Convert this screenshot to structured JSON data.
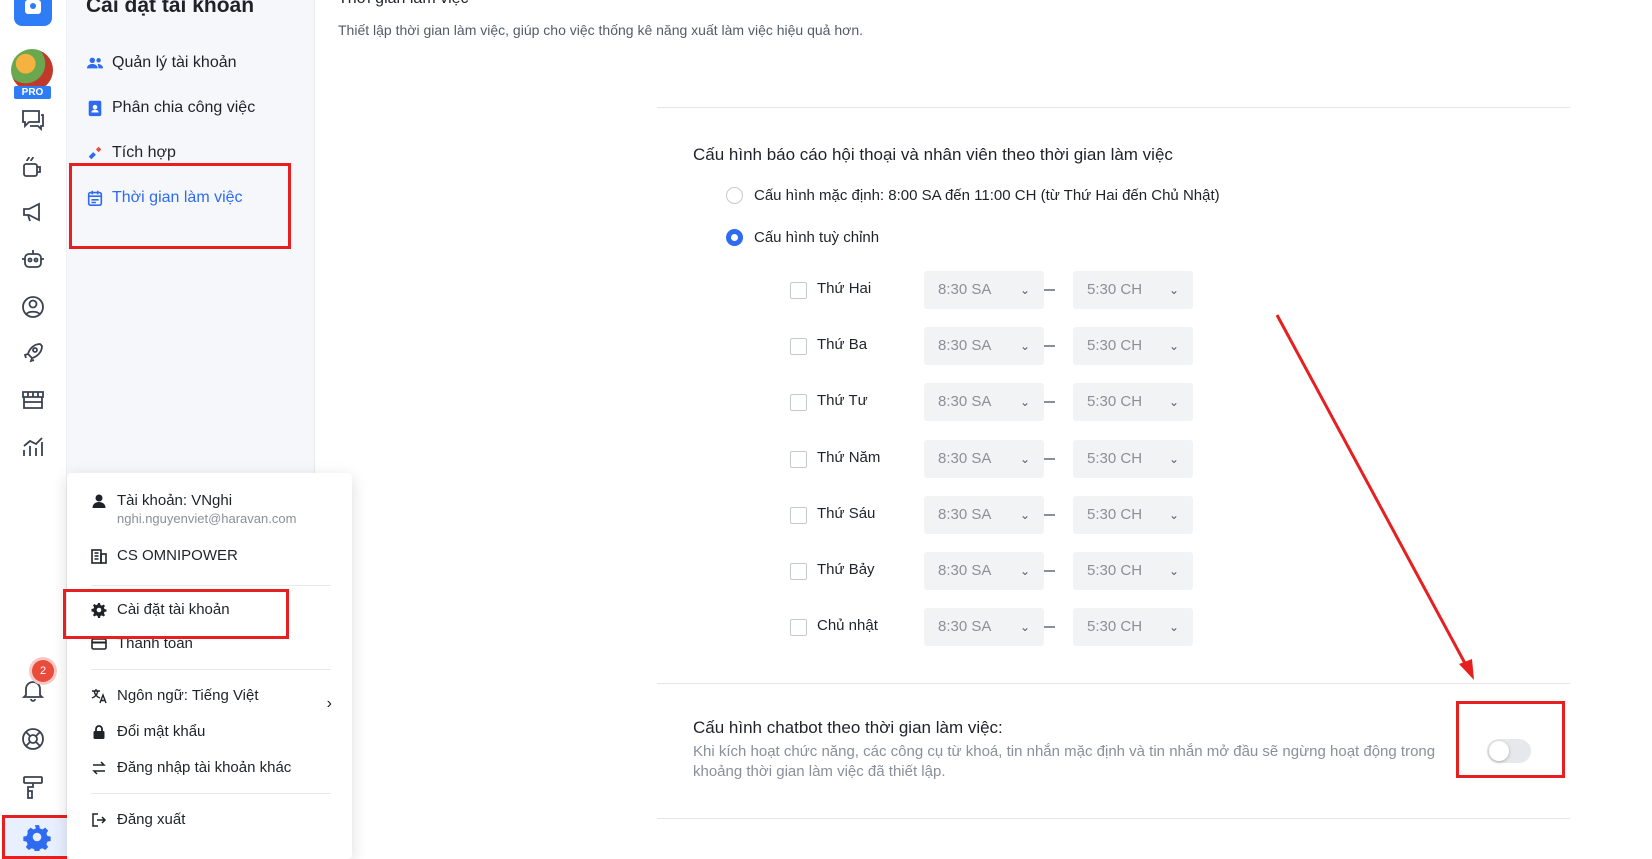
{
  "sidebar": {
    "title": "Cài đặt tài khoản",
    "pro_badge": "PRO",
    "items": [
      {
        "label": "Quản lý tài khoản",
        "icon": "users-icon"
      },
      {
        "label": "Phân chia công việc",
        "icon": "badge-icon"
      },
      {
        "label": "Tích hợp",
        "icon": "puzzle-icon"
      },
      {
        "label": "Thời gian làm việc",
        "icon": "calendar-icon",
        "active": true
      }
    ]
  },
  "rail": {
    "notification_count": "2",
    "icons": [
      "chat-icon",
      "coffee-icon",
      "megaphone-icon",
      "robot-icon",
      "user-circle-icon",
      "rocket-icon",
      "store-icon",
      "chart-icon",
      "bell-icon",
      "help-icon",
      "paint-roller-icon",
      "gear-icon"
    ]
  },
  "popup": {
    "account_label": "Tài khoản: VNghi",
    "account_email": "nghi.nguyenviet@haravan.com",
    "org": "CS OMNIPOWER",
    "settings": "Cài đặt tài khoản",
    "billing": "Thanh toán",
    "language": "Ngôn ngữ: Tiếng Việt",
    "change_password": "Đổi mật khẩu",
    "switch_account": "Đăng nhập tài khoản khác",
    "logout": "Đăng xuất"
  },
  "main": {
    "title": "Thời gian làm việc",
    "description": "Thiết lập thời gian làm việc, giúp cho việc thống kê năng xuất làm việc hiệu quả hơn.",
    "report_section_title": "Cấu hình báo cáo hội thoại và nhân viên theo thời gian làm việc",
    "option_default": "Cấu hình mặc định: 8:00 SA đến 11:00 CH (từ Thứ Hai đến Chủ Nhật)",
    "option_custom": "Cấu hình tuỳ chỉnh",
    "selected_option": "custom",
    "days": [
      {
        "label": "Thứ Hai",
        "start": "8:30 SA",
        "end": "5:30 CH",
        "checked": false
      },
      {
        "label": "Thứ Ba",
        "start": "8:30 SA",
        "end": "5:30 CH",
        "checked": false
      },
      {
        "label": "Thứ Tư",
        "start": "8:30 SA",
        "end": "5:30 CH",
        "checked": false
      },
      {
        "label": "Thứ Năm",
        "start": "8:30 SA",
        "end": "5:30 CH",
        "checked": false
      },
      {
        "label": "Thứ Sáu",
        "start": "8:30 SA",
        "end": "5:30 CH",
        "checked": false
      },
      {
        "label": "Thứ Bảy",
        "start": "8:30 SA",
        "end": "5:30 CH",
        "checked": false
      },
      {
        "label": "Chủ nhật",
        "start": "8:30 SA",
        "end": "5:30 CH",
        "checked": false
      }
    ],
    "chatbot_title": "Cấu hình chatbot theo thời gian làm việc:",
    "chatbot_desc": "Khi kích hoạt chức năng, các công cụ từ khoá, tin nhắn mặc định và tin nhắn mở đầu sẽ ngừng hoạt động trong khoảng thời gian làm việc đã thiết lập.",
    "chatbot_enabled": false
  },
  "colors": {
    "accent": "#2e6bf1",
    "annotation": "#e62020",
    "badge": "#e94b3c"
  }
}
